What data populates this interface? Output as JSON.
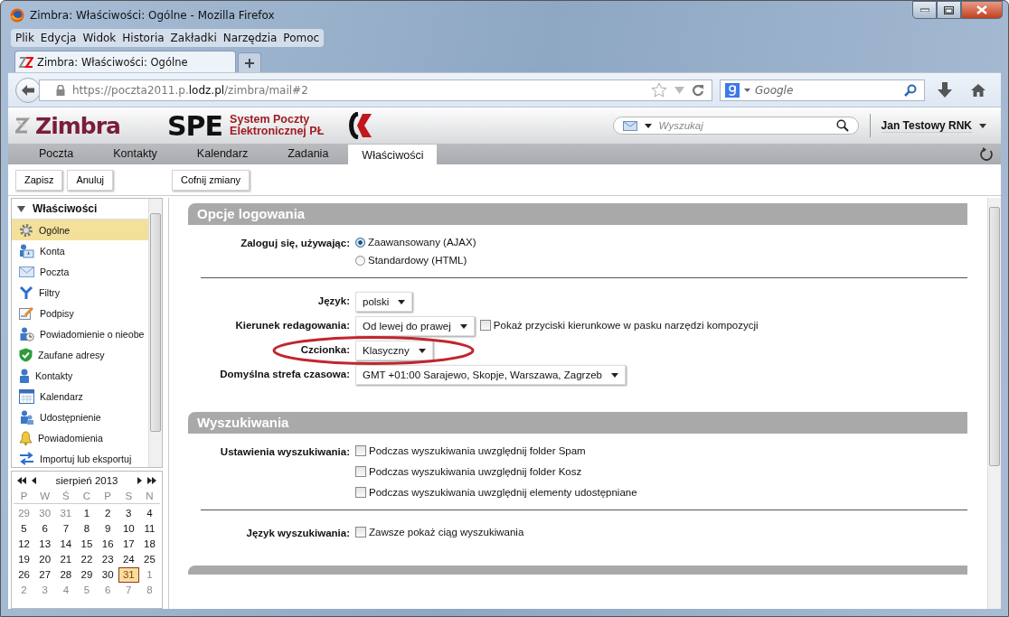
{
  "window": {
    "title": "Zimbra: Właściwości: Ogólne - Mozilla Firefox"
  },
  "menu": [
    "Plik",
    "Edycja",
    "Widok",
    "Historia",
    "Zakładki",
    "Narzędzia",
    "Pomoc"
  ],
  "browser_tabs": [
    {
      "label": "Zimbra: Właściwości: Ogólne",
      "selected": true
    }
  ],
  "address": {
    "url_parts": [
      {
        "text": "https://poczta2011.p.",
        "highlight": false
      },
      {
        "text": "lodz.pl",
        "highlight": true
      },
      {
        "text": "/zimbra/mail#2",
        "highlight": false
      }
    ]
  },
  "web_search": {
    "placeholder": "Google"
  },
  "app_header": {
    "logo": "Zimbra",
    "brand": "SPE",
    "brand_subtitle": [
      "System Poczty",
      "Elektronicznej PŁ"
    ],
    "search_placeholder": "Wyszukaj",
    "user": "Jan Testowy RNK"
  },
  "app_tabs": [
    {
      "label": "Poczta",
      "selected": false
    },
    {
      "label": "Kontakty",
      "selected": false
    },
    {
      "label": "Kalendarz",
      "selected": false
    },
    {
      "label": "Zadania",
      "selected": false
    },
    {
      "label": "Właściwości",
      "selected": true
    }
  ],
  "toolbar": [
    "Zapisz",
    "Anuluj",
    "Cofnij zmiany"
  ],
  "sidebar": {
    "header": "Właściwości",
    "expanded": true,
    "items": [
      {
        "label": "Ogólne",
        "selected": true
      },
      {
        "label": "Konta",
        "selected": false
      },
      {
        "label": "Poczta",
        "selected": false
      },
      {
        "label": "Filtry",
        "selected": false
      },
      {
        "label": "Podpisy",
        "selected": false
      },
      {
        "label": "Powiadomienie o nieobe",
        "selected": false
      },
      {
        "label": "Zaufane adresy",
        "selected": false
      },
      {
        "label": "Kontakty",
        "selected": false
      },
      {
        "label": "Kalendarz",
        "selected": false
      },
      {
        "label": "Udostępnienie",
        "selected": false
      },
      {
        "label": "Powiadomienia",
        "selected": false
      },
      {
        "label": "Importuj lub eksportuj",
        "selected": false
      }
    ]
  },
  "calendar": {
    "month": "sierpień 2013",
    "weekdays": [
      "P",
      "W",
      "Ś",
      "C",
      "P",
      "S",
      "N"
    ],
    "weeks": [
      [
        {
          "day": "29",
          "muted": true,
          "selected": false
        },
        {
          "day": "30",
          "muted": true,
          "selected": false
        },
        {
          "day": "31",
          "muted": true,
          "selected": false
        },
        {
          "day": "1",
          "muted": false,
          "selected": false
        },
        {
          "day": "2",
          "muted": false,
          "selected": false
        },
        {
          "day": "3",
          "muted": false,
          "selected": false
        },
        {
          "day": "4",
          "muted": false,
          "selected": false
        }
      ],
      [
        {
          "day": "5",
          "muted": false,
          "selected": false
        },
        {
          "day": "6",
          "muted": false,
          "selected": false
        },
        {
          "day": "7",
          "muted": false,
          "selected": false
        },
        {
          "day": "8",
          "muted": false,
          "selected": false
        },
        {
          "day": "9",
          "muted": false,
          "selected": false
        },
        {
          "day": "10",
          "muted": false,
          "selected": false
        },
        {
          "day": "11",
          "muted": false,
          "selected": false
        }
      ],
      [
        {
          "day": "12",
          "muted": false,
          "selected": false
        },
        {
          "day": "13",
          "muted": false,
          "selected": false
        },
        {
          "day": "14",
          "muted": false,
          "selected": false
        },
        {
          "day": "15",
          "muted": false,
          "selected": false
        },
        {
          "day": "16",
          "muted": false,
          "selected": false
        },
        {
          "day": "17",
          "muted": false,
          "selected": false
        },
        {
          "day": "18",
          "muted": false,
          "selected": false
        }
      ],
      [
        {
          "day": "19",
          "muted": false,
          "selected": false
        },
        {
          "day": "20",
          "muted": false,
          "selected": false
        },
        {
          "day": "21",
          "muted": false,
          "selected": false
        },
        {
          "day": "22",
          "muted": false,
          "selected": false
        },
        {
          "day": "23",
          "muted": false,
          "selected": false
        },
        {
          "day": "24",
          "muted": false,
          "selected": false
        },
        {
          "day": "25",
          "muted": false,
          "selected": false
        }
      ],
      [
        {
          "day": "26",
          "muted": false,
          "selected": false
        },
        {
          "day": "27",
          "muted": false,
          "selected": false
        },
        {
          "day": "28",
          "muted": false,
          "selected": false
        },
        {
          "day": "29",
          "muted": false,
          "selected": false
        },
        {
          "day": "30",
          "muted": false,
          "selected": false
        },
        {
          "day": "31",
          "muted": false,
          "selected": true
        },
        {
          "day": "1",
          "muted": true,
          "selected": false
        }
      ],
      [
        {
          "day": "2",
          "muted": true,
          "selected": false
        },
        {
          "day": "3",
          "muted": true,
          "selected": false
        },
        {
          "day": "4",
          "muted": true,
          "selected": false
        },
        {
          "day": "5",
          "muted": true,
          "selected": false
        },
        {
          "day": "6",
          "muted": true,
          "selected": false
        },
        {
          "day": "7",
          "muted": true,
          "selected": false
        },
        {
          "day": "8",
          "muted": true,
          "selected": false
        }
      ]
    ]
  },
  "sections": [
    {
      "title": "Opcje logowania",
      "rows": [
        {
          "kind": "radio",
          "label": "Zaloguj się, używając:",
          "options": [
            {
              "label": "Zaawansowany (AJAX)",
              "selected": true
            },
            {
              "label": "Standardowy (HTML)",
              "selected": false
            }
          ]
        },
        {
          "kind": "divider"
        },
        {
          "kind": "select",
          "label": "Język:",
          "value": "polski",
          "annotated": false
        },
        {
          "kind": "select",
          "label": "Kierunek redagowania:",
          "value": "Od lewej do prawej",
          "annotated": false,
          "checkbox": {
            "label": "Pokaż przyciski kierunkowe w pasku narzędzi kompozycji",
            "checked": false
          }
        },
        {
          "kind": "select",
          "label": "Czcionka:",
          "value": "Klasyczny",
          "annotated": true
        },
        {
          "kind": "select",
          "label": "Domyślna strefa czasowa:",
          "value": "GMT +01:00 Sarajewo, Skopje, Warszawa, Zagrzeb",
          "annotated": false
        }
      ]
    },
    {
      "title": "Wyszukiwania",
      "rows": [
        {
          "kind": "checkboxes",
          "label": "Ustawienia wyszukiwania:",
          "options": [
            {
              "label": "Podczas wyszukiwania uwzględnij folder Spam",
              "checked": false
            },
            {
              "label": "Podczas wyszukiwania uwzględnij folder Kosz",
              "checked": false
            },
            {
              "label": "Podczas wyszukiwania uwzględnij elementy udostępniane",
              "checked": false
            }
          ]
        },
        {
          "kind": "divider"
        },
        {
          "kind": "checkboxes",
          "label": "Język wyszukiwania:",
          "options": [
            {
              "label": "Zawsze pokaż ciąg wyszukiwania",
              "checked": false
            }
          ]
        }
      ]
    }
  ]
}
